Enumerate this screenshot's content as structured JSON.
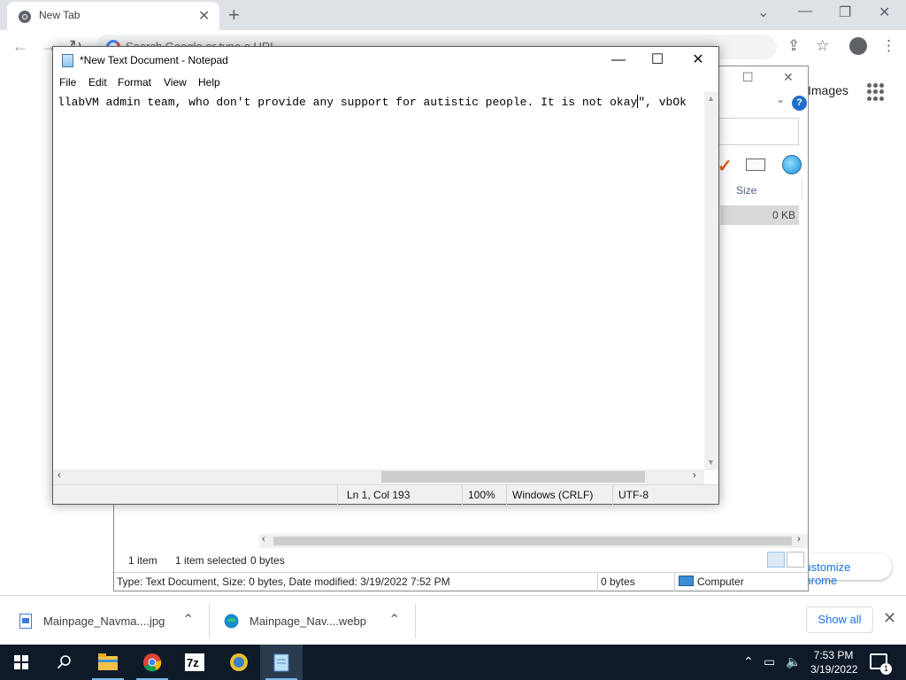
{
  "chrome": {
    "tab_title": "New Tab",
    "omnibox_placeholder": "Search Google or type a URL",
    "ntp_images_link": "Images",
    "customize_label": "Customize Chrome"
  },
  "explorer": {
    "column_size": "Size",
    "selected_row_size": "0 KB",
    "status_item_count": "1 item",
    "status_selected": "1 item selected",
    "status_bytes": "0 bytes",
    "details_text": "Type: Text Document, Size: 0 bytes, Date modified: 3/19/2022 7:52 PM",
    "details_bytes": "0 bytes",
    "details_location": "Computer"
  },
  "notepad": {
    "title": "*New Text Document - Notepad",
    "menu": [
      "File",
      "Edit",
      "Format",
      "View",
      "Help"
    ],
    "text_before_caret": "llabVM admin team, who don't provide any support for autistic people. It is not okay",
    "text_after_caret": "\", vbOk",
    "status": {
      "position": "Ln 1, Col 193",
      "zoom": "100%",
      "line_ending": "Windows (CRLF)",
      "encoding": "UTF-8"
    }
  },
  "downloads": {
    "items": [
      {
        "name": "Mainpage_Navma....jpg",
        "icon": "image-file-icon"
      },
      {
        "name": "Mainpage_Nav....webp",
        "icon": "edge-icon"
      }
    ],
    "show_all": "Show all"
  },
  "taskbar": {
    "apps": [
      "start-icon",
      "search-icon",
      "file-explorer-icon",
      "chrome-icon",
      "7zip-icon",
      "shell-app-icon",
      "notepad-icon"
    ],
    "time": "7:53 PM",
    "date": "3/19/2022",
    "notification_count": "1"
  }
}
